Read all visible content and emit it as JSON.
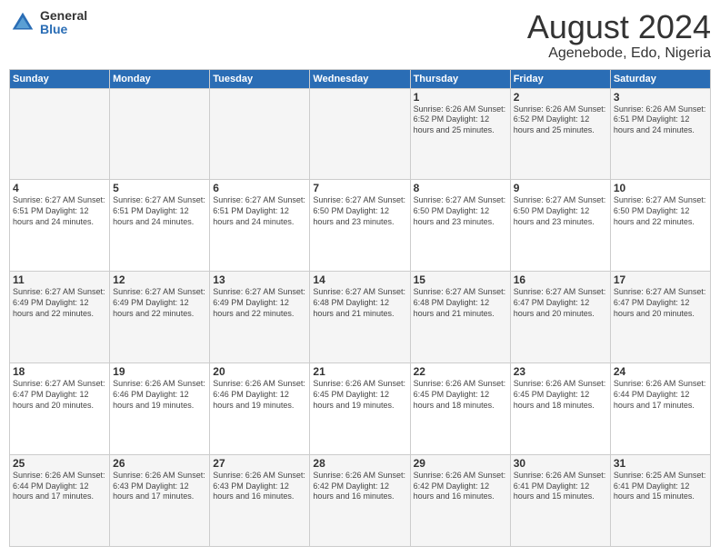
{
  "logo": {
    "general": "General",
    "blue": "Blue"
  },
  "title": "August 2024",
  "subtitle": "Agenebode, Edo, Nigeria",
  "days_of_week": [
    "Sunday",
    "Monday",
    "Tuesday",
    "Wednesday",
    "Thursday",
    "Friday",
    "Saturday"
  ],
  "weeks": [
    [
      {
        "day": "",
        "info": ""
      },
      {
        "day": "",
        "info": ""
      },
      {
        "day": "",
        "info": ""
      },
      {
        "day": "",
        "info": ""
      },
      {
        "day": "1",
        "info": "Sunrise: 6:26 AM\nSunset: 6:52 PM\nDaylight: 12 hours and 25 minutes."
      },
      {
        "day": "2",
        "info": "Sunrise: 6:26 AM\nSunset: 6:52 PM\nDaylight: 12 hours and 25 minutes."
      },
      {
        "day": "3",
        "info": "Sunrise: 6:26 AM\nSunset: 6:51 PM\nDaylight: 12 hours and 24 minutes."
      }
    ],
    [
      {
        "day": "4",
        "info": "Sunrise: 6:27 AM\nSunset: 6:51 PM\nDaylight: 12 hours and 24 minutes."
      },
      {
        "day": "5",
        "info": "Sunrise: 6:27 AM\nSunset: 6:51 PM\nDaylight: 12 hours and 24 minutes."
      },
      {
        "day": "6",
        "info": "Sunrise: 6:27 AM\nSunset: 6:51 PM\nDaylight: 12 hours and 24 minutes."
      },
      {
        "day": "7",
        "info": "Sunrise: 6:27 AM\nSunset: 6:50 PM\nDaylight: 12 hours and 23 minutes."
      },
      {
        "day": "8",
        "info": "Sunrise: 6:27 AM\nSunset: 6:50 PM\nDaylight: 12 hours and 23 minutes."
      },
      {
        "day": "9",
        "info": "Sunrise: 6:27 AM\nSunset: 6:50 PM\nDaylight: 12 hours and 23 minutes."
      },
      {
        "day": "10",
        "info": "Sunrise: 6:27 AM\nSunset: 6:50 PM\nDaylight: 12 hours and 22 minutes."
      }
    ],
    [
      {
        "day": "11",
        "info": "Sunrise: 6:27 AM\nSunset: 6:49 PM\nDaylight: 12 hours and 22 minutes."
      },
      {
        "day": "12",
        "info": "Sunrise: 6:27 AM\nSunset: 6:49 PM\nDaylight: 12 hours and 22 minutes."
      },
      {
        "day": "13",
        "info": "Sunrise: 6:27 AM\nSunset: 6:49 PM\nDaylight: 12 hours and 22 minutes."
      },
      {
        "day": "14",
        "info": "Sunrise: 6:27 AM\nSunset: 6:48 PM\nDaylight: 12 hours and 21 minutes."
      },
      {
        "day": "15",
        "info": "Sunrise: 6:27 AM\nSunset: 6:48 PM\nDaylight: 12 hours and 21 minutes."
      },
      {
        "day": "16",
        "info": "Sunrise: 6:27 AM\nSunset: 6:47 PM\nDaylight: 12 hours and 20 minutes."
      },
      {
        "day": "17",
        "info": "Sunrise: 6:27 AM\nSunset: 6:47 PM\nDaylight: 12 hours and 20 minutes."
      }
    ],
    [
      {
        "day": "18",
        "info": "Sunrise: 6:27 AM\nSunset: 6:47 PM\nDaylight: 12 hours and 20 minutes."
      },
      {
        "day": "19",
        "info": "Sunrise: 6:26 AM\nSunset: 6:46 PM\nDaylight: 12 hours and 19 minutes."
      },
      {
        "day": "20",
        "info": "Sunrise: 6:26 AM\nSunset: 6:46 PM\nDaylight: 12 hours and 19 minutes."
      },
      {
        "day": "21",
        "info": "Sunrise: 6:26 AM\nSunset: 6:45 PM\nDaylight: 12 hours and 19 minutes."
      },
      {
        "day": "22",
        "info": "Sunrise: 6:26 AM\nSunset: 6:45 PM\nDaylight: 12 hours and 18 minutes."
      },
      {
        "day": "23",
        "info": "Sunrise: 6:26 AM\nSunset: 6:45 PM\nDaylight: 12 hours and 18 minutes."
      },
      {
        "day": "24",
        "info": "Sunrise: 6:26 AM\nSunset: 6:44 PM\nDaylight: 12 hours and 17 minutes."
      }
    ],
    [
      {
        "day": "25",
        "info": "Sunrise: 6:26 AM\nSunset: 6:44 PM\nDaylight: 12 hours and 17 minutes."
      },
      {
        "day": "26",
        "info": "Sunrise: 6:26 AM\nSunset: 6:43 PM\nDaylight: 12 hours and 17 minutes."
      },
      {
        "day": "27",
        "info": "Sunrise: 6:26 AM\nSunset: 6:43 PM\nDaylight: 12 hours and 16 minutes."
      },
      {
        "day": "28",
        "info": "Sunrise: 6:26 AM\nSunset: 6:42 PM\nDaylight: 12 hours and 16 minutes."
      },
      {
        "day": "29",
        "info": "Sunrise: 6:26 AM\nSunset: 6:42 PM\nDaylight: 12 hours and 16 minutes."
      },
      {
        "day": "30",
        "info": "Sunrise: 6:26 AM\nSunset: 6:41 PM\nDaylight: 12 hours and 15 minutes."
      },
      {
        "day": "31",
        "info": "Sunrise: 6:25 AM\nSunset: 6:41 PM\nDaylight: 12 hours and 15 minutes."
      }
    ]
  ]
}
